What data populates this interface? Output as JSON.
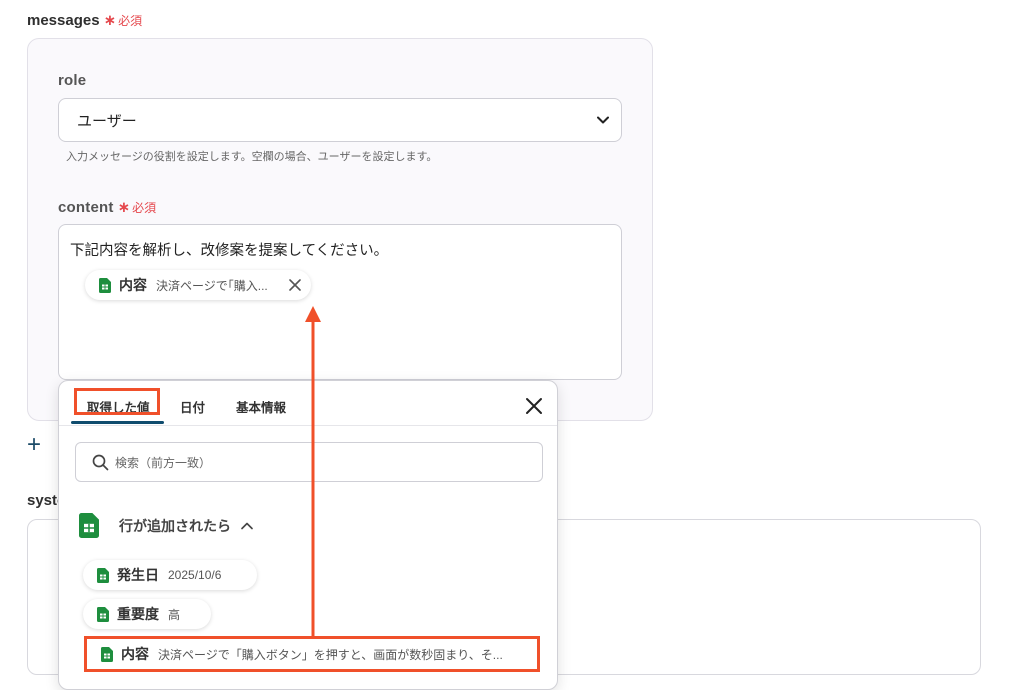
{
  "messages": {
    "label": "messages",
    "required_star": "∗",
    "required_text": "必須",
    "role": {
      "label": "role",
      "selected": "ユーザー",
      "hint": "入力メッセージの役割を設定します。空欄の場合、ユーザーを設定します。"
    },
    "content": {
      "label": "content",
      "required_star": "∗",
      "required_text": "必須",
      "text": "下記内容を解析し、改修案を提案してください。",
      "token": {
        "name": "内容",
        "value": "決済ページで｢購入..."
      }
    }
  },
  "add_button": "+",
  "system": {
    "label_visible": "syste"
  },
  "picker": {
    "tabs": [
      {
        "label": "取得した値"
      },
      {
        "label": "日付"
      },
      {
        "label": "基本情報"
      }
    ],
    "search_placeholder": "検索（前方一致）",
    "group": {
      "title": "行が追加されたら"
    },
    "items": [
      {
        "name": "発生日",
        "value": "2025/10/6"
      },
      {
        "name": "重要度",
        "value": "高"
      },
      {
        "name": "内容",
        "value": "決済ページで「購入ボタン」を押すと、画面が数秒固まり、そ..."
      }
    ]
  },
  "colors": {
    "accent": "#0f4c6e",
    "required": "#e5484d",
    "annotation": "#f0502a",
    "sheets_green": "#1e8e3e"
  },
  "icons": [
    "sheets-icon",
    "close-icon",
    "search-icon",
    "chevron-up-icon",
    "chevron-down-icon",
    "plus-icon"
  ]
}
